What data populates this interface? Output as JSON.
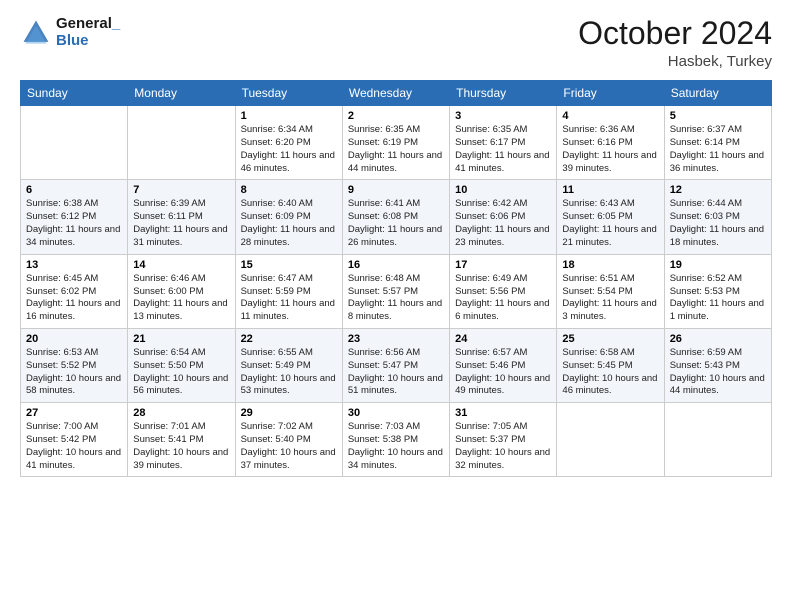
{
  "header": {
    "logo_line1": "General",
    "logo_line2": "Blue",
    "month_title": "October 2024",
    "subtitle": "Hasbek, Turkey"
  },
  "weekdays": [
    "Sunday",
    "Monday",
    "Tuesday",
    "Wednesday",
    "Thursday",
    "Friday",
    "Saturday"
  ],
  "weeks": [
    [
      null,
      null,
      {
        "day": "1",
        "sunrise": "Sunrise: 6:34 AM",
        "sunset": "Sunset: 6:20 PM",
        "daylight": "Daylight: 11 hours and 46 minutes."
      },
      {
        "day": "2",
        "sunrise": "Sunrise: 6:35 AM",
        "sunset": "Sunset: 6:19 PM",
        "daylight": "Daylight: 11 hours and 44 minutes."
      },
      {
        "day": "3",
        "sunrise": "Sunrise: 6:35 AM",
        "sunset": "Sunset: 6:17 PM",
        "daylight": "Daylight: 11 hours and 41 minutes."
      },
      {
        "day": "4",
        "sunrise": "Sunrise: 6:36 AM",
        "sunset": "Sunset: 6:16 PM",
        "daylight": "Daylight: 11 hours and 39 minutes."
      },
      {
        "day": "5",
        "sunrise": "Sunrise: 6:37 AM",
        "sunset": "Sunset: 6:14 PM",
        "daylight": "Daylight: 11 hours and 36 minutes."
      }
    ],
    [
      {
        "day": "6",
        "sunrise": "Sunrise: 6:38 AM",
        "sunset": "Sunset: 6:12 PM",
        "daylight": "Daylight: 11 hours and 34 minutes."
      },
      {
        "day": "7",
        "sunrise": "Sunrise: 6:39 AM",
        "sunset": "Sunset: 6:11 PM",
        "daylight": "Daylight: 11 hours and 31 minutes."
      },
      {
        "day": "8",
        "sunrise": "Sunrise: 6:40 AM",
        "sunset": "Sunset: 6:09 PM",
        "daylight": "Daylight: 11 hours and 28 minutes."
      },
      {
        "day": "9",
        "sunrise": "Sunrise: 6:41 AM",
        "sunset": "Sunset: 6:08 PM",
        "daylight": "Daylight: 11 hours and 26 minutes."
      },
      {
        "day": "10",
        "sunrise": "Sunrise: 6:42 AM",
        "sunset": "Sunset: 6:06 PM",
        "daylight": "Daylight: 11 hours and 23 minutes."
      },
      {
        "day": "11",
        "sunrise": "Sunrise: 6:43 AM",
        "sunset": "Sunset: 6:05 PM",
        "daylight": "Daylight: 11 hours and 21 minutes."
      },
      {
        "day": "12",
        "sunrise": "Sunrise: 6:44 AM",
        "sunset": "Sunset: 6:03 PM",
        "daylight": "Daylight: 11 hours and 18 minutes."
      }
    ],
    [
      {
        "day": "13",
        "sunrise": "Sunrise: 6:45 AM",
        "sunset": "Sunset: 6:02 PM",
        "daylight": "Daylight: 11 hours and 16 minutes."
      },
      {
        "day": "14",
        "sunrise": "Sunrise: 6:46 AM",
        "sunset": "Sunset: 6:00 PM",
        "daylight": "Daylight: 11 hours and 13 minutes."
      },
      {
        "day": "15",
        "sunrise": "Sunrise: 6:47 AM",
        "sunset": "Sunset: 5:59 PM",
        "daylight": "Daylight: 11 hours and 11 minutes."
      },
      {
        "day": "16",
        "sunrise": "Sunrise: 6:48 AM",
        "sunset": "Sunset: 5:57 PM",
        "daylight": "Daylight: 11 hours and 8 minutes."
      },
      {
        "day": "17",
        "sunrise": "Sunrise: 6:49 AM",
        "sunset": "Sunset: 5:56 PM",
        "daylight": "Daylight: 11 hours and 6 minutes."
      },
      {
        "day": "18",
        "sunrise": "Sunrise: 6:51 AM",
        "sunset": "Sunset: 5:54 PM",
        "daylight": "Daylight: 11 hours and 3 minutes."
      },
      {
        "day": "19",
        "sunrise": "Sunrise: 6:52 AM",
        "sunset": "Sunset: 5:53 PM",
        "daylight": "Daylight: 11 hours and 1 minute."
      }
    ],
    [
      {
        "day": "20",
        "sunrise": "Sunrise: 6:53 AM",
        "sunset": "Sunset: 5:52 PM",
        "daylight": "Daylight: 10 hours and 58 minutes."
      },
      {
        "day": "21",
        "sunrise": "Sunrise: 6:54 AM",
        "sunset": "Sunset: 5:50 PM",
        "daylight": "Daylight: 10 hours and 56 minutes."
      },
      {
        "day": "22",
        "sunrise": "Sunrise: 6:55 AM",
        "sunset": "Sunset: 5:49 PM",
        "daylight": "Daylight: 10 hours and 53 minutes."
      },
      {
        "day": "23",
        "sunrise": "Sunrise: 6:56 AM",
        "sunset": "Sunset: 5:47 PM",
        "daylight": "Daylight: 10 hours and 51 minutes."
      },
      {
        "day": "24",
        "sunrise": "Sunrise: 6:57 AM",
        "sunset": "Sunset: 5:46 PM",
        "daylight": "Daylight: 10 hours and 49 minutes."
      },
      {
        "day": "25",
        "sunrise": "Sunrise: 6:58 AM",
        "sunset": "Sunset: 5:45 PM",
        "daylight": "Daylight: 10 hours and 46 minutes."
      },
      {
        "day": "26",
        "sunrise": "Sunrise: 6:59 AM",
        "sunset": "Sunset: 5:43 PM",
        "daylight": "Daylight: 10 hours and 44 minutes."
      }
    ],
    [
      {
        "day": "27",
        "sunrise": "Sunrise: 7:00 AM",
        "sunset": "Sunset: 5:42 PM",
        "daylight": "Daylight: 10 hours and 41 minutes."
      },
      {
        "day": "28",
        "sunrise": "Sunrise: 7:01 AM",
        "sunset": "Sunset: 5:41 PM",
        "daylight": "Daylight: 10 hours and 39 minutes."
      },
      {
        "day": "29",
        "sunrise": "Sunrise: 7:02 AM",
        "sunset": "Sunset: 5:40 PM",
        "daylight": "Daylight: 10 hours and 37 minutes."
      },
      {
        "day": "30",
        "sunrise": "Sunrise: 7:03 AM",
        "sunset": "Sunset: 5:38 PM",
        "daylight": "Daylight: 10 hours and 34 minutes."
      },
      {
        "day": "31",
        "sunrise": "Sunrise: 7:05 AM",
        "sunset": "Sunset: 5:37 PM",
        "daylight": "Daylight: 10 hours and 32 minutes."
      },
      null,
      null
    ]
  ]
}
